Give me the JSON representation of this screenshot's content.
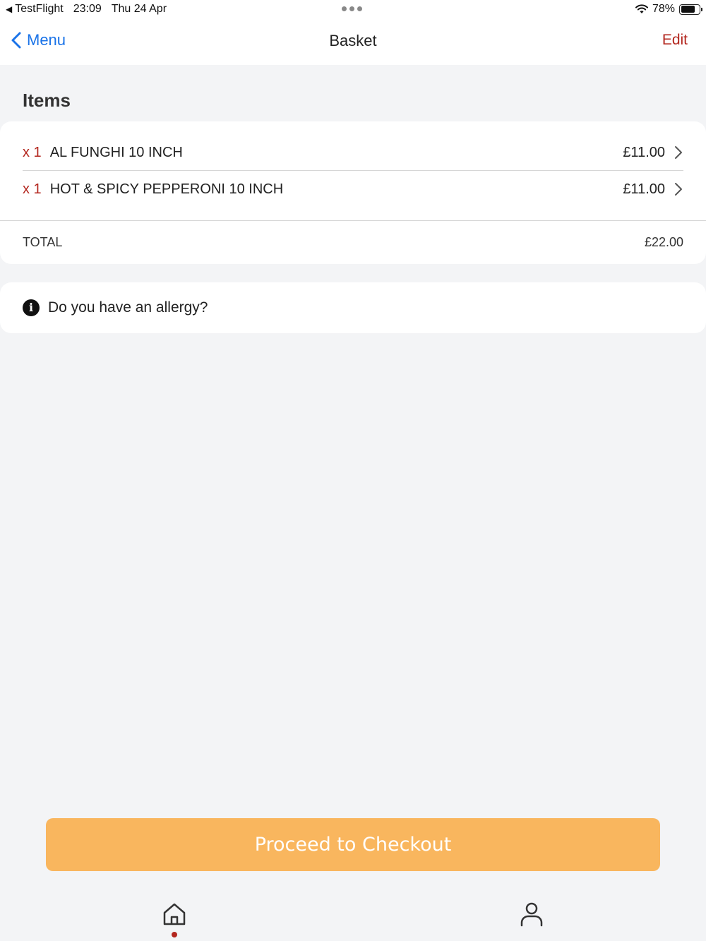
{
  "status_bar": {
    "app": "TestFlight",
    "time": "23:09",
    "date": "Thu 24 Apr",
    "battery": "78%",
    "battery_level": 0.78
  },
  "nav": {
    "back_label": "Menu",
    "title": "Basket",
    "edit_label": "Edit"
  },
  "items_section": {
    "title": "Items",
    "items": [
      {
        "qty": "x 1",
        "name": "AL FUNGHI 10 INCH",
        "price": "£11.00"
      },
      {
        "qty": "x 1",
        "name": "HOT & SPICY PEPPERONI 10 INCH",
        "price": "£11.00"
      }
    ],
    "total_label": "TOTAL",
    "total_value": "£22.00"
  },
  "allergy": {
    "icon": "info-icon",
    "label": "Do you have an allergy?"
  },
  "checkout": {
    "label": "Proceed to Checkout"
  },
  "tab_bar": {
    "icons": [
      "home-icon",
      "profile-icon"
    ],
    "active": "home-icon"
  },
  "colors": {
    "accent_red": "#b3261e",
    "link_blue": "#1a73e8",
    "checkout_orange": "#f9b65e",
    "background": "#f3f4f6"
  }
}
